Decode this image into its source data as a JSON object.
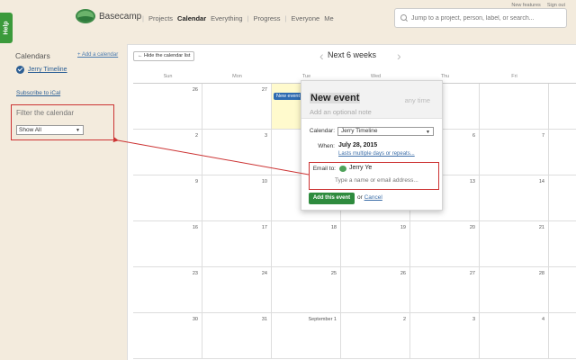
{
  "help_tab": "Help",
  "app": {
    "name": "Basecamp"
  },
  "nav": [
    "Projects",
    "Calendar",
    "Everything",
    "Progress",
    "Everyone",
    "Me"
  ],
  "toplinks": [
    "New features",
    "Sign out"
  ],
  "search": {
    "placeholder": "Jump to a project, person, label, or search..."
  },
  "sidebar": {
    "title": "Calendars",
    "add_link": "+ Add a calendar",
    "calendars": [
      {
        "label": "Jerry Timeline"
      }
    ],
    "subscribe": "Subscribe to iCal",
    "filter_label": "Filter the calendar",
    "filter_value": "Show All"
  },
  "calendar": {
    "hide_button": "← Hide the calendar list",
    "range_title": "Next 6 weeks",
    "weekdays": [
      "Sun",
      "Mon",
      "Tue",
      "Wed",
      "Thu",
      "Fri",
      "Sat"
    ],
    "weeks": [
      [
        "26",
        "27",
        "",
        "",
        "",
        "",
        "Aug"
      ],
      [
        "2",
        "3",
        "",
        "",
        "6",
        "7",
        "8"
      ],
      [
        "9",
        "10",
        "",
        "",
        "13",
        "14",
        "15"
      ],
      [
        "16",
        "17",
        "18",
        "19",
        "20",
        "21",
        "22"
      ],
      [
        "23",
        "24",
        "25",
        "26",
        "27",
        "28",
        "29"
      ],
      [
        "30",
        "31",
        "September 1",
        "2",
        "3",
        "4",
        "5"
      ]
    ],
    "event_chip": "New event"
  },
  "popup": {
    "title": "New event",
    "time_placeholder": "any time",
    "note_placeholder": "Add an optional note",
    "calendar_label": "Calendar:",
    "calendar_value": "Jerry Timeline",
    "when_label": "When:",
    "when_value": "July 28, 2015",
    "multi_link": "Lasts multiple days or repeats...",
    "email_label": "Email to:",
    "email_person": "Jerry Ye",
    "email_placeholder": "Type a name or email address...",
    "add_button": "Add this event",
    "or_text": "or",
    "cancel_link": "Cancel"
  },
  "colors": {
    "annotation": "#cc3333",
    "accent_green": "#2e8b3e",
    "link_blue": "#2a5e95",
    "background": "#f3ebdd"
  }
}
